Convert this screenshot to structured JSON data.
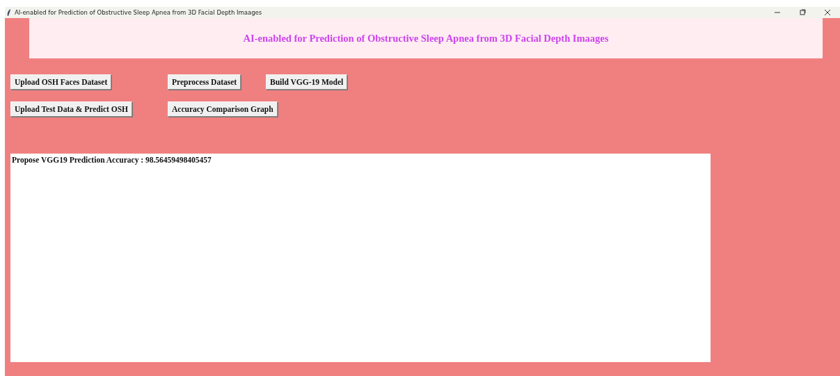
{
  "window": {
    "title": "AI-enabled for Prediction of Obstructive Sleep Apnea from 3D Facial Depth Imaages"
  },
  "heading": "AI-enabled for Prediction of Obstructive Sleep Apnea from 3D Facial Depth Imaages",
  "buttons": [
    [
      "Upload OSH Faces Dataset",
      "Preprocess Dataset",
      "Build VGG-19 Model"
    ],
    [
      "Upload Test Data & Predict OSH",
      "Accuracy Comparison Graph"
    ]
  ],
  "output": {
    "text": "Propose VGG19 Prediction Accuracy : 98.56459498405457"
  }
}
